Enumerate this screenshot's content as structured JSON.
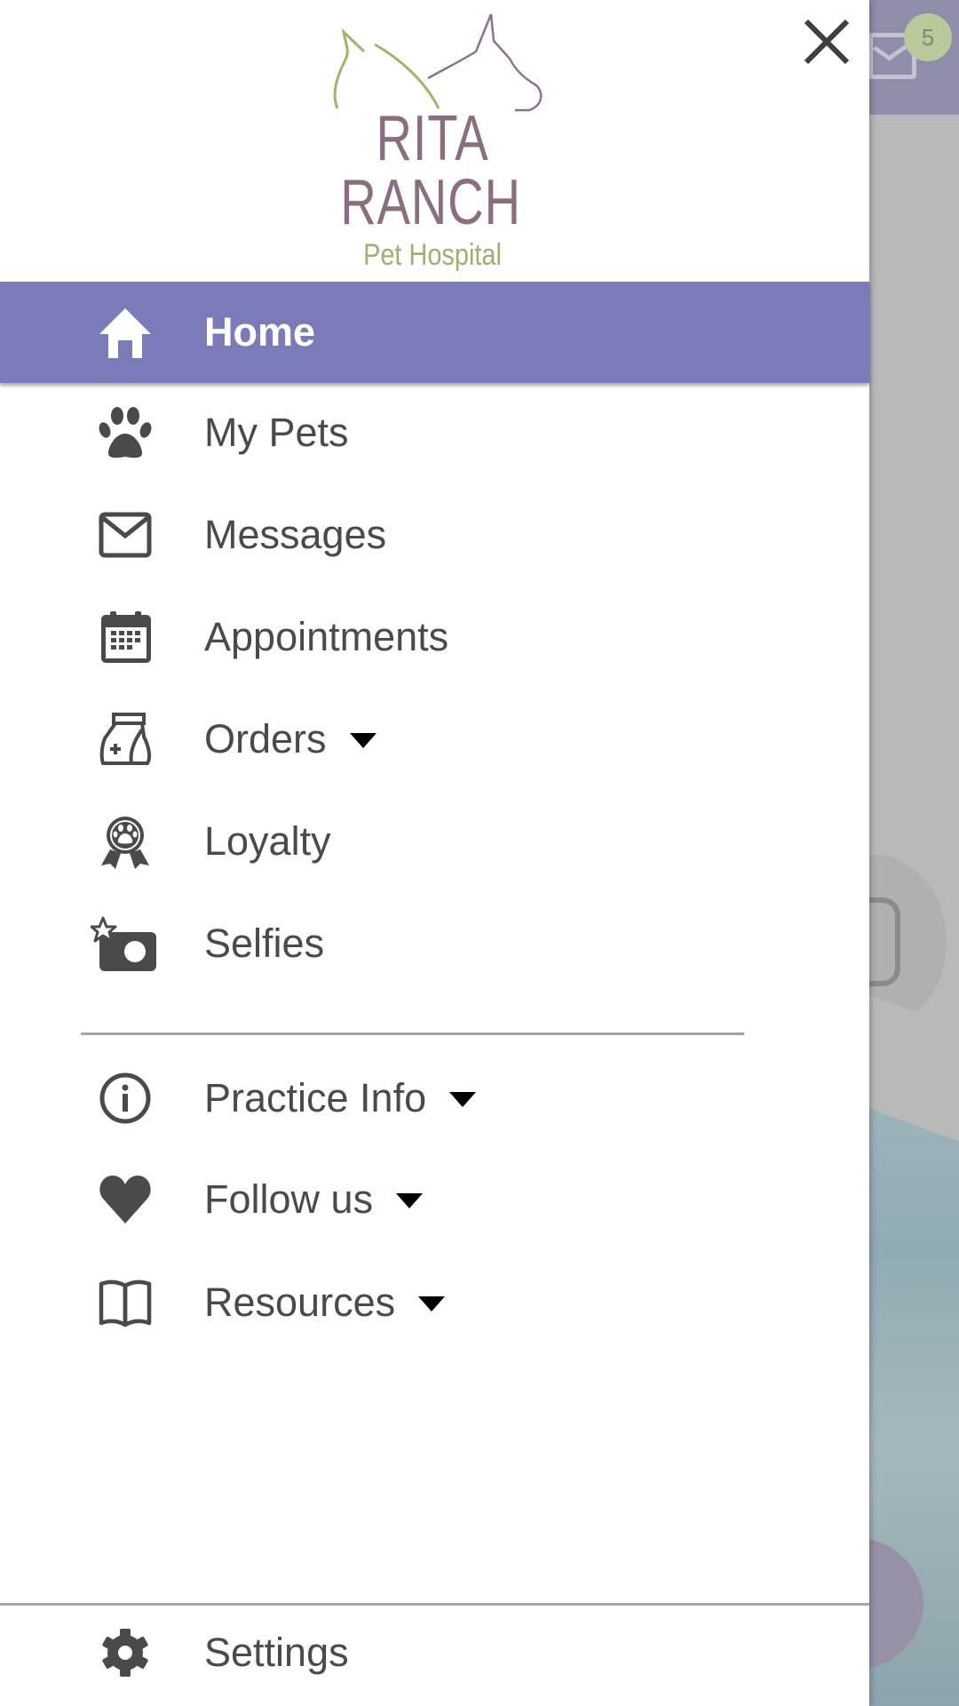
{
  "background": {
    "notification_count": "5",
    "header_icon": "mail-icon"
  },
  "drawer": {
    "close_icon": "close-icon",
    "logo": {
      "line1": "RITA",
      "line2": "RANCH",
      "line3": "Pet Hospital"
    },
    "primary_items": [
      {
        "label": "Home",
        "icon": "home-icon",
        "active": true,
        "expandable": false
      },
      {
        "label": "My Pets",
        "icon": "paw-icon",
        "active": false,
        "expandable": false
      },
      {
        "label": "Messages",
        "icon": "envelope-icon",
        "active": false,
        "expandable": false
      },
      {
        "label": "Appointments",
        "icon": "calendar-icon",
        "active": false,
        "expandable": false
      },
      {
        "label": "Orders",
        "icon": "food-bag-icon",
        "active": false,
        "expandable": true
      },
      {
        "label": "Loyalty",
        "icon": "award-ribbon-icon",
        "active": false,
        "expandable": false
      },
      {
        "label": "Selfies",
        "icon": "camera-star-icon",
        "active": false,
        "expandable": false
      }
    ],
    "secondary_items": [
      {
        "label": "Practice Info",
        "icon": "info-icon",
        "expandable": true
      },
      {
        "label": "Follow us",
        "icon": "heart-icon",
        "expandable": true
      },
      {
        "label": "Resources",
        "icon": "book-icon",
        "expandable": true
      }
    ],
    "footer_item": {
      "label": "Settings",
      "icon": "gear-icon"
    }
  },
  "colors": {
    "active_bg": "#7c7bb9",
    "text": "#4a4a4a",
    "logo_purple": "#8a6e80",
    "logo_green": "#9fae72"
  }
}
